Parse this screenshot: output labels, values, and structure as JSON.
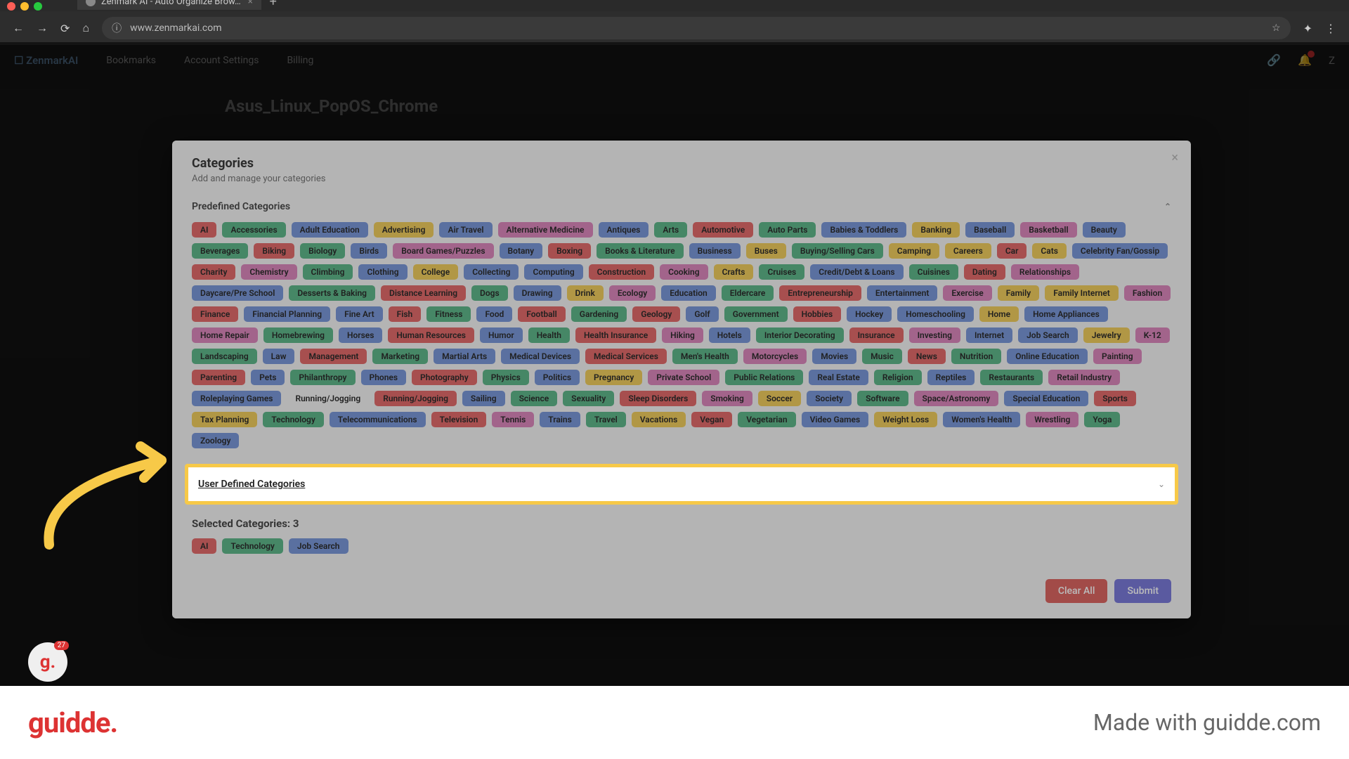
{
  "browser": {
    "tab_title": "Zenmark AI - Auto Organize Brow…",
    "url": "www.zenmarkai.com"
  },
  "app": {
    "logo": "☐ ZenmarkAI",
    "nav": [
      "Bookmarks",
      "Account Settings",
      "Billing"
    ],
    "avatar_letter": "Z",
    "page_heading": "Asus_Linux_PopOS_Chrome"
  },
  "modal": {
    "title": "Categories",
    "subtitle": "Add and manage your categories",
    "predefined_header": "Predefined Categories",
    "user_defined_header": "User Defined Categories",
    "selected_header": "Selected Categories: 3",
    "clear_label": "Clear All",
    "submit_label": "Submit",
    "categories": [
      {
        "name": "AI",
        "color": "#e05a5a"
      },
      {
        "name": "Accessories",
        "color": "#4caf7d"
      },
      {
        "name": "Adult Education",
        "color": "#6b8cd6"
      },
      {
        "name": "Advertising",
        "color": "#f0c84a"
      },
      {
        "name": "Air Travel",
        "color": "#6b8cd6"
      },
      {
        "name": "Alternative Medicine",
        "color": "#d97ab5"
      },
      {
        "name": "Antiques",
        "color": "#6b8cd6"
      },
      {
        "name": "Arts",
        "color": "#4caf7d"
      },
      {
        "name": "Automotive",
        "color": "#e05a5a"
      },
      {
        "name": "Auto Parts",
        "color": "#4caf7d"
      },
      {
        "name": "Babies & Toddlers",
        "color": "#6b8cd6"
      },
      {
        "name": "Banking",
        "color": "#f0c84a"
      },
      {
        "name": "Baseball",
        "color": "#6b8cd6"
      },
      {
        "name": "Basketball",
        "color": "#d97ab5"
      },
      {
        "name": "Beauty",
        "color": "#6b8cd6"
      },
      {
        "name": "Beverages",
        "color": "#4caf7d"
      },
      {
        "name": "Biking",
        "color": "#e05a5a"
      },
      {
        "name": "Biology",
        "color": "#4caf7d"
      },
      {
        "name": "Birds",
        "color": "#6b8cd6"
      },
      {
        "name": "Board Games/Puzzles",
        "color": "#d97ab5"
      },
      {
        "name": "Botany",
        "color": "#6b8cd6"
      },
      {
        "name": "Boxing",
        "color": "#e05a5a"
      },
      {
        "name": "Books & Literature",
        "color": "#4caf7d"
      },
      {
        "name": "Business",
        "color": "#6b8cd6"
      },
      {
        "name": "Buses",
        "color": "#f0c84a"
      },
      {
        "name": "Buying/Selling Cars",
        "color": "#4caf7d"
      },
      {
        "name": "Camping",
        "color": "#f0c84a"
      },
      {
        "name": "Careers",
        "color": "#f0c84a"
      },
      {
        "name": "Car",
        "color": "#e05a5a"
      },
      {
        "name": "Cats",
        "color": "#f0c84a"
      },
      {
        "name": "Celebrity Fan/Gossip",
        "color": "#6b8cd6"
      },
      {
        "name": "Charity",
        "color": "#e05a5a"
      },
      {
        "name": "Chemistry",
        "color": "#d97ab5"
      },
      {
        "name": "Climbing",
        "color": "#4caf7d"
      },
      {
        "name": "Clothing",
        "color": "#6b8cd6"
      },
      {
        "name": "College",
        "color": "#f0c84a"
      },
      {
        "name": "Collecting",
        "color": "#6b8cd6"
      },
      {
        "name": "Computing",
        "color": "#6b8cd6"
      },
      {
        "name": "Construction",
        "color": "#e05a5a"
      },
      {
        "name": "Cooking",
        "color": "#d97ab5"
      },
      {
        "name": "Crafts",
        "color": "#f0c84a"
      },
      {
        "name": "Cruises",
        "color": "#4caf7d"
      },
      {
        "name": "Credit/Debt & Loans",
        "color": "#6b8cd6"
      },
      {
        "name": "Cuisines",
        "color": "#4caf7d"
      },
      {
        "name": "Dating",
        "color": "#e05a5a"
      },
      {
        "name": "Relationships",
        "color": "#d97ab5"
      },
      {
        "name": "Daycare/Pre School",
        "color": "#6b8cd6"
      },
      {
        "name": "Desserts & Baking",
        "color": "#4caf7d"
      },
      {
        "name": "Distance Learning",
        "color": "#e05a5a"
      },
      {
        "name": "Dogs",
        "color": "#4caf7d"
      },
      {
        "name": "Drawing",
        "color": "#6b8cd6"
      },
      {
        "name": "Drink",
        "color": "#f0c84a"
      },
      {
        "name": "Ecology",
        "color": "#d97ab5"
      },
      {
        "name": "Education",
        "color": "#6b8cd6"
      },
      {
        "name": "Eldercare",
        "color": "#4caf7d"
      },
      {
        "name": "Entrepreneurship",
        "color": "#e05a5a"
      },
      {
        "name": "Entertainment",
        "color": "#6b8cd6"
      },
      {
        "name": "Exercise",
        "color": "#d97ab5"
      },
      {
        "name": "Family",
        "color": "#f0c84a"
      },
      {
        "name": "Family Internet",
        "color": "#f0c84a"
      },
      {
        "name": "Fashion",
        "color": "#d97ab5"
      },
      {
        "name": "Finance",
        "color": "#e05a5a"
      },
      {
        "name": "Financial Planning",
        "color": "#6b8cd6"
      },
      {
        "name": "Fine Art",
        "color": "#6b8cd6"
      },
      {
        "name": "Fish",
        "color": "#e05a5a"
      },
      {
        "name": "Fitness",
        "color": "#4caf7d"
      },
      {
        "name": "Food",
        "color": "#6b8cd6"
      },
      {
        "name": "Football",
        "color": "#e05a5a"
      },
      {
        "name": "Gardening",
        "color": "#4caf7d"
      },
      {
        "name": "Geology",
        "color": "#e05a5a"
      },
      {
        "name": "Golf",
        "color": "#6b8cd6"
      },
      {
        "name": "Government",
        "color": "#4caf7d"
      },
      {
        "name": "Hobbies",
        "color": "#e05a5a"
      },
      {
        "name": "Hockey",
        "color": "#6b8cd6"
      },
      {
        "name": "Homeschooling",
        "color": "#6b8cd6"
      },
      {
        "name": "Home",
        "color": "#f0c84a"
      },
      {
        "name": "Home Appliances",
        "color": "#6b8cd6"
      },
      {
        "name": "Home Repair",
        "color": "#d97ab5"
      },
      {
        "name": "Homebrewing",
        "color": "#4caf7d"
      },
      {
        "name": "Horses",
        "color": "#6b8cd6"
      },
      {
        "name": "Human Resources",
        "color": "#e05a5a"
      },
      {
        "name": "Humor",
        "color": "#6b8cd6"
      },
      {
        "name": "Health",
        "color": "#4caf7d"
      },
      {
        "name": "Health Insurance",
        "color": "#e05a5a"
      },
      {
        "name": "Hiking",
        "color": "#d97ab5"
      },
      {
        "name": "Hotels",
        "color": "#6b8cd6"
      },
      {
        "name": "Interior Decorating",
        "color": "#4caf7d"
      },
      {
        "name": "Insurance",
        "color": "#e05a5a"
      },
      {
        "name": "Investing",
        "color": "#d97ab5"
      },
      {
        "name": "Internet",
        "color": "#6b8cd6"
      },
      {
        "name": "Job Search",
        "color": "#6b8cd6"
      },
      {
        "name": "Jewelry",
        "color": "#f0c84a"
      },
      {
        "name": "K-12",
        "color": "#d97ab5"
      },
      {
        "name": "Landscaping",
        "color": "#4caf7d"
      },
      {
        "name": "Law",
        "color": "#6b8cd6"
      },
      {
        "name": "Management",
        "color": "#e05a5a"
      },
      {
        "name": "Marketing",
        "color": "#4caf7d"
      },
      {
        "name": "Martial Arts",
        "color": "#6b8cd6"
      },
      {
        "name": "Medical Devices",
        "color": "#6b8cd6"
      },
      {
        "name": "Medical Services",
        "color": "#e05a5a"
      },
      {
        "name": "Men's Health",
        "color": "#4caf7d"
      },
      {
        "name": "Motorcycles",
        "color": "#d97ab5"
      },
      {
        "name": "Movies",
        "color": "#6b8cd6"
      },
      {
        "name": "Music",
        "color": "#4caf7d"
      },
      {
        "name": "News",
        "color": "#e05a5a"
      },
      {
        "name": "Nutrition",
        "color": "#4caf7d"
      },
      {
        "name": "Online Education",
        "color": "#6b8cd6"
      },
      {
        "name": "Painting",
        "color": "#d97ab5"
      },
      {
        "name": "Parenting",
        "color": "#e05a5a"
      },
      {
        "name": "Pets",
        "color": "#6b8cd6"
      },
      {
        "name": "Philanthropy",
        "color": "#4caf7d"
      },
      {
        "name": "Phones",
        "color": "#6b8cd6"
      },
      {
        "name": "Photography",
        "color": "#e05a5a"
      },
      {
        "name": "Physics",
        "color": "#4caf7d"
      },
      {
        "name": "Politics",
        "color": "#6b8cd6"
      },
      {
        "name": "Pregnancy",
        "color": "#f0c84a"
      },
      {
        "name": "Private School",
        "color": "#d97ab5"
      },
      {
        "name": "Public Relations",
        "color": "#4caf7d"
      },
      {
        "name": "Real Estate",
        "color": "#6b8cd6"
      },
      {
        "name": "Religion",
        "color": "#4caf7d"
      },
      {
        "name": "Reptiles",
        "color": "#6b8cd6"
      },
      {
        "name": "Restaurants",
        "color": "#4caf7d"
      },
      {
        "name": "Retail Industry",
        "color": "#d97ab5"
      },
      {
        "name": "Roleplaying Games",
        "color": "#6b8cd6"
      },
      {
        "name": "Running/Jogging",
        "color": "#la"
      },
      {
        "name": "Running/Jogging",
        "color": "#e05a5a"
      },
      {
        "name": "Sailing",
        "color": "#6b8cd6"
      },
      {
        "name": "Science",
        "color": "#4caf7d"
      },
      {
        "name": "Sexuality",
        "color": "#4caf7d"
      },
      {
        "name": "Sleep Disorders",
        "color": "#e05a5a"
      },
      {
        "name": "Smoking",
        "color": "#d97ab5"
      },
      {
        "name": "Soccer",
        "color": "#f0c84a"
      },
      {
        "name": "Society",
        "color": "#6b8cd6"
      },
      {
        "name": "Software",
        "color": "#4caf7d"
      },
      {
        "name": "Space/Astronomy",
        "color": "#d97ab5"
      },
      {
        "name": "Special Education",
        "color": "#6b8cd6"
      },
      {
        "name": "Sports",
        "color": "#e05a5a"
      },
      {
        "name": "Tax Planning",
        "color": "#f0c84a"
      },
      {
        "name": "Technology",
        "color": "#4caf7d"
      },
      {
        "name": "Telecommunications",
        "color": "#6b8cd6"
      },
      {
        "name": "Television",
        "color": "#e05a5a"
      },
      {
        "name": "Tennis",
        "color": "#d97ab5"
      },
      {
        "name": "Trains",
        "color": "#6b8cd6"
      },
      {
        "name": "Travel",
        "color": "#4caf7d"
      },
      {
        "name": "Vacations",
        "color": "#f0c84a"
      },
      {
        "name": "Vegan",
        "color": "#e05a5a"
      },
      {
        "name": "Vegetarian",
        "color": "#4caf7d"
      },
      {
        "name": "Video Games",
        "color": "#6b8cd6"
      },
      {
        "name": "Weight Loss",
        "color": "#f0c84a"
      },
      {
        "name": "Women's Health",
        "color": "#6b8cd6"
      },
      {
        "name": "Wrestling",
        "color": "#d97ab5"
      },
      {
        "name": "Yoga",
        "color": "#4caf7d"
      },
      {
        "name": "Zoology",
        "color": "#6b8cd6"
      }
    ],
    "selected": [
      {
        "name": "AI",
        "color": "#e05a5a"
      },
      {
        "name": "Technology",
        "color": "#4caf7d"
      },
      {
        "name": "Job Search",
        "color": "#6b8cd6"
      }
    ]
  },
  "guidde_badge": {
    "count": "27"
  },
  "footer": {
    "logo": "guidde.",
    "right": "Made with guidde.com"
  }
}
